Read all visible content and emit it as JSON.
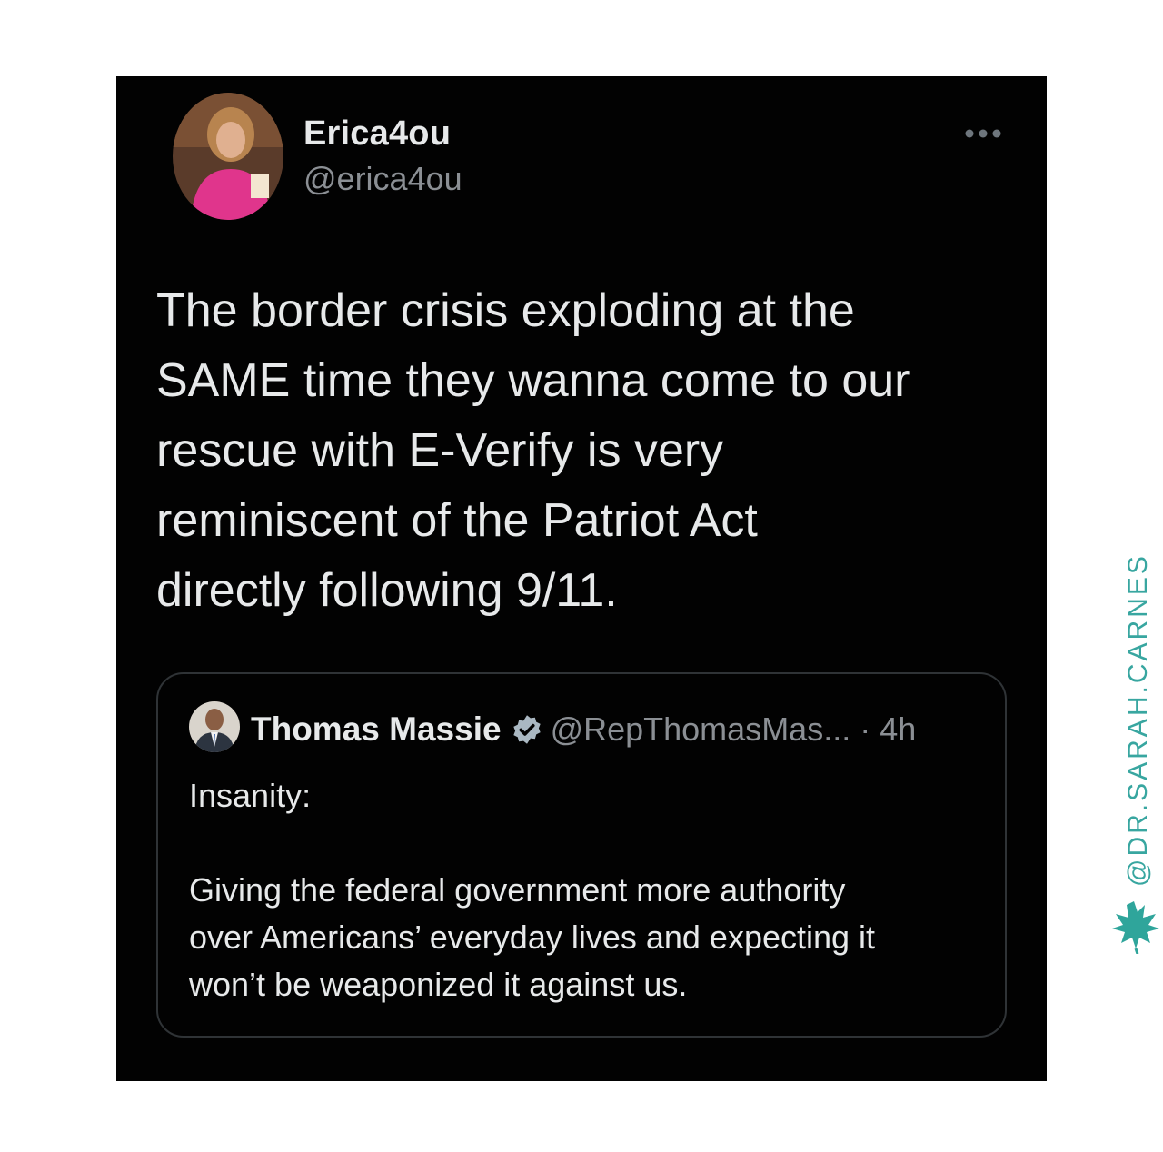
{
  "tweet": {
    "display_name": "Erica4ou",
    "handle": "@erica4ou",
    "text": "The border crisis exploding at the\nSAME time they wanna come to our\nrescue with E-Verify is very\nreminiscent of the Patriot Act\ndirectly following 9/11."
  },
  "quoted_tweet": {
    "display_name": "Thomas Massie",
    "handle": "@RepThomasMas...",
    "time": "· 4h",
    "text": "Insanity:\n\nGiving the federal government more authority\nover Americans’ everyday lives and expecting it\nwon’t be weaponized it against us."
  },
  "watermark": {
    "text": "@DR.SARAH.CARNES"
  },
  "colors": {
    "card_bg": "#020202",
    "text_primary": "#e7e9ea",
    "text_secondary": "#8b8f94",
    "verified": "#aab8c2",
    "watermark": "#38a6a0"
  },
  "icons": [
    "more-icon",
    "verified-icon",
    "leaf-icon"
  ]
}
